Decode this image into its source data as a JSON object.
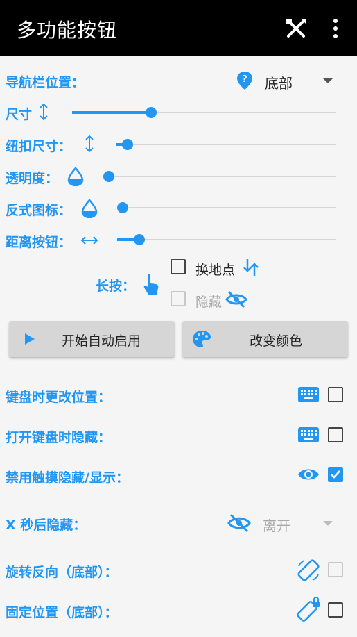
{
  "appbar": {
    "title": "多功能按钮",
    "tools_icon": "design-tools-icon",
    "more_icon": "more-vert-icon"
  },
  "nav_position": {
    "label": "导航栏位置：",
    "value": "底部",
    "icon": "help-marker-icon"
  },
  "size": {
    "label": "尺寸",
    "value": 0.3
  },
  "button_size": {
    "label": "纽扣尺寸：",
    "value": 0.05
  },
  "opacity": {
    "label": "透明度：",
    "value": 0.0
  },
  "inverse_icon": {
    "label": "反式图标：",
    "value": 0.0
  },
  "distance": {
    "label": "距离按钮：",
    "value": 0.1
  },
  "long_press": {
    "label": "长按：",
    "swap_label": "换地点",
    "swap_checked": false,
    "hide_label": "隐藏",
    "hide_checked": false,
    "hide_disabled": true
  },
  "buttons": {
    "auto_start": "开始自动启用",
    "change_color": "改变颜色"
  },
  "settings": {
    "keyboard_change_position": {
      "label": "键盘时更改位置：",
      "checked": false
    },
    "hide_on_keyboard": {
      "label": "打开键盘时隐藏：",
      "checked": false
    },
    "disable_touch_hide": {
      "label": "禁用触摸隐藏/显示：",
      "checked": true
    },
    "hide_after_x": {
      "label": "X 秒后隐藏：",
      "value": "离开"
    },
    "rotate_reverse": {
      "label": "旋转反向（底部）：",
      "checked": false,
      "disabled": true
    },
    "fixed_position": {
      "label": "固定位置（底部）：",
      "checked": false
    }
  },
  "colors": {
    "accent": "#2196f3",
    "appbar": "#000000",
    "background": "#f5f5f5"
  }
}
